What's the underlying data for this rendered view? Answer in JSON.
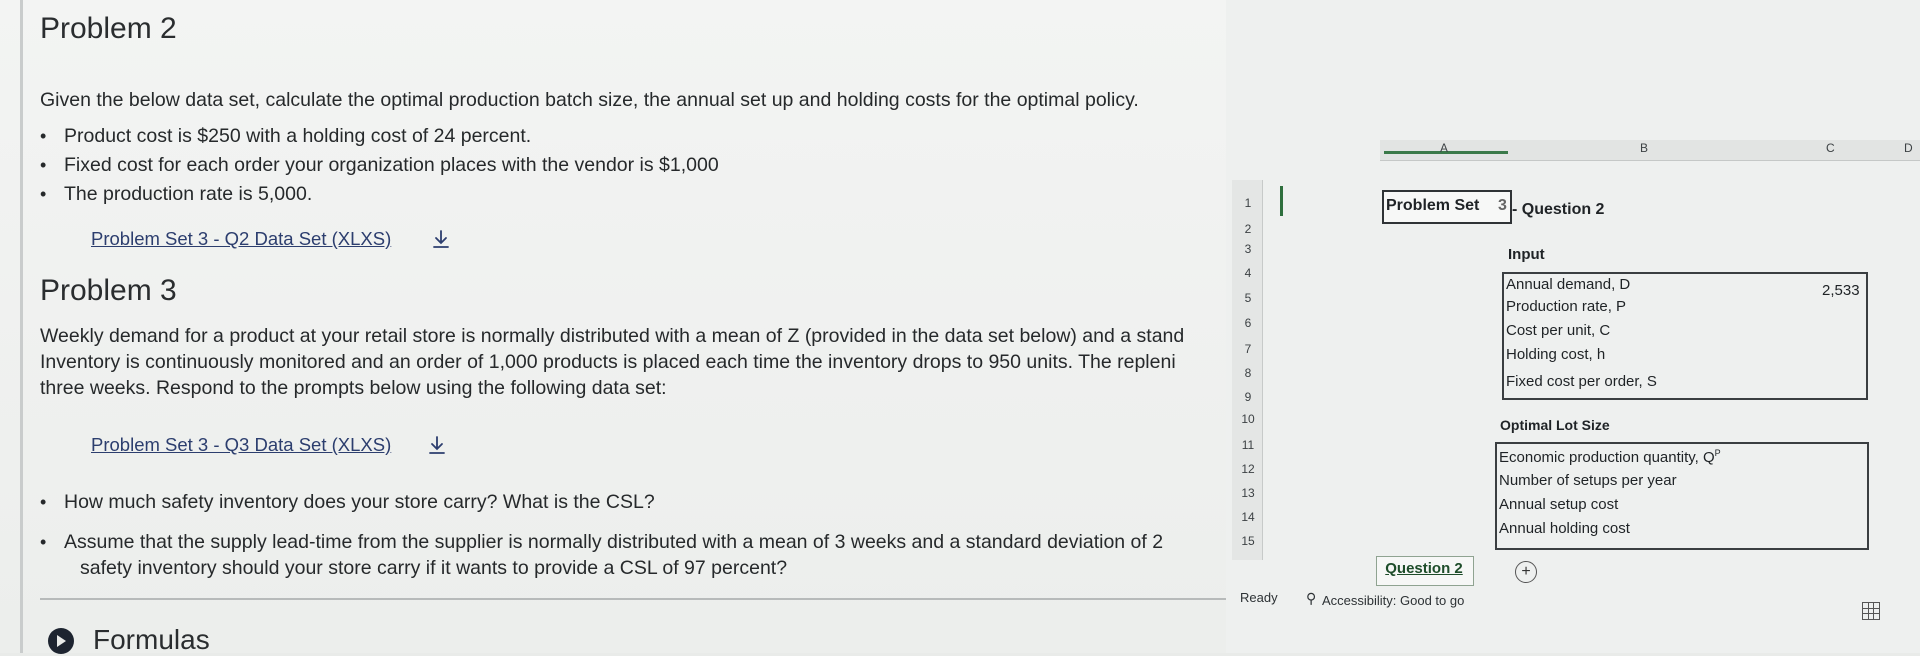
{
  "page": {
    "problem2": {
      "heading": "Problem 2",
      "intro": "Given the below data set, calculate the optimal production batch size, the annual set up and holding costs for the optimal policy.",
      "bullets": [
        "Product cost is $250 with a holding cost of 24 percent.",
        "Fixed cost for each order your organization places with the vendor is $1,000",
        "The production rate is 5,000."
      ],
      "link": "Problem Set 3 - Q2 Data Set (XLXS)"
    },
    "problem3": {
      "heading": "Problem 3",
      "para_lines": [
        "Weekly demand for a product at your retail store is normally distributed with a mean of Z (provided in the data set below) and a stand",
        "Inventory is continuously monitored and an order of 1,000 products is placed each time the inventory drops to 950 units. The repleni",
        "three weeks. Respond to the prompts below using the following data set:"
      ],
      "link": "Problem Set 3 - Q3 Data Set (XLXS)",
      "bullets": [
        "How much safety inventory does your store carry? What is the CSL?",
        "Assume that the supply lead-time from the supplier is normally distributed with a mean of 3 weeks and a standard deviation of 2"
      ],
      "bullet2_cont": "safety inventory should your store carry if it wants to provide a CSL of 97 percent?"
    },
    "formulas_label": "Formulas"
  },
  "spreadsheet": {
    "columns": [
      "A",
      "B",
      "C",
      "D"
    ],
    "rows": [
      "1",
      "2",
      "3",
      "4",
      "5",
      "6",
      "7",
      "8",
      "9",
      "10",
      "11",
      "12",
      "13",
      "14",
      "15"
    ],
    "title_part1": "Problem Set ",
    "title_part2": "3",
    "title_part3": " - Question 2",
    "input_label": "Input",
    "inputs": [
      {
        "label": "Annual demand, D",
        "value": "2,533"
      },
      {
        "label": "Production rate, P",
        "value": ""
      },
      {
        "label": "Cost per unit, C",
        "value": ""
      },
      {
        "label": "Holding cost, h",
        "value": ""
      },
      {
        "label": "Fixed cost per order, S",
        "value": ""
      }
    ],
    "output_label": "Optimal Lot Size",
    "outputs": [
      {
        "label": "Economic production quantity, Q",
        "sup": "P"
      },
      {
        "label": "Number of setups per year"
      },
      {
        "label": "Annual setup cost"
      },
      {
        "label": "Annual holding cost"
      }
    ],
    "sheet_tab": "Question 2",
    "add_sheet": "+",
    "status_ready": "Ready",
    "status_accessibility": "Accessibility: Good to go"
  }
}
